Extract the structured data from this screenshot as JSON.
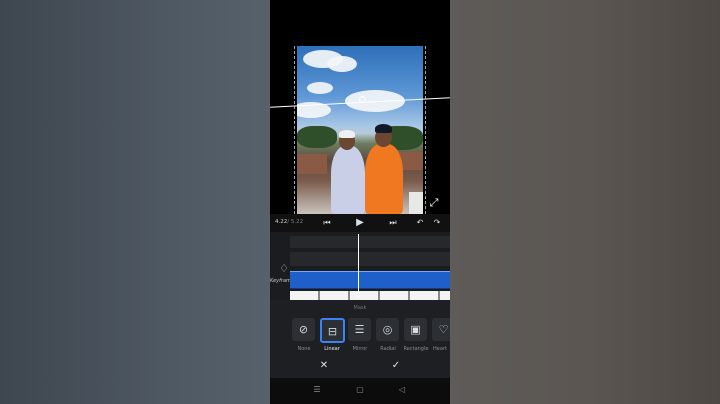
{
  "player": {
    "current_time": "4.22",
    "total_time": "/ 5.22"
  },
  "timeline": {
    "keyframe_label": "Keyframe"
  },
  "mask_panel": {
    "title": "Mask",
    "options": [
      {
        "label": "None",
        "icon": "none-icon",
        "selected": false
      },
      {
        "label": "Linear",
        "icon": "linear-mask-icon",
        "selected": true
      },
      {
        "label": "Mirror",
        "icon": "mirror-mask-icon",
        "selected": false
      },
      {
        "label": "Radial",
        "icon": "radial-mask-icon",
        "selected": false
      },
      {
        "label": "Rectangle",
        "icon": "rectangle-mask-icon",
        "selected": false
      },
      {
        "label": "Heart",
        "icon": "heart-mask-icon",
        "selected": false
      }
    ]
  },
  "colors": {
    "accent": "#3b82f6",
    "clip_blue": "#1f5fc9"
  }
}
